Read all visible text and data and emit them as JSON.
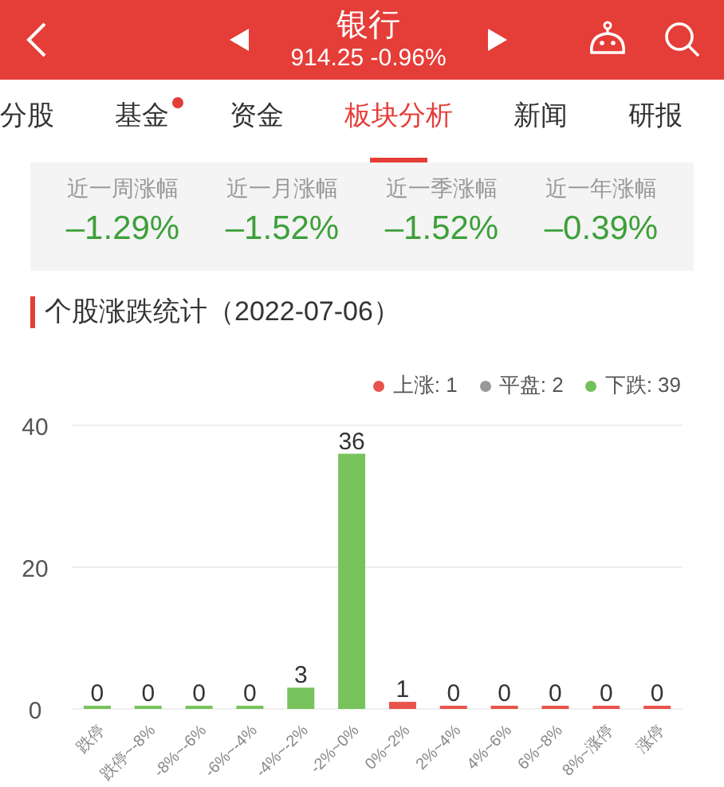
{
  "header": {
    "title": "银行",
    "quote": "914.25 -0.96%"
  },
  "tabs": [
    {
      "label": "分股",
      "selected": false,
      "dot": false
    },
    {
      "label": "基金",
      "selected": false,
      "dot": true
    },
    {
      "label": "资金",
      "selected": false,
      "dot": false
    },
    {
      "label": "板块分析",
      "selected": true,
      "dot": false
    },
    {
      "label": "新闻",
      "selected": false,
      "dot": false
    },
    {
      "label": "研报",
      "selected": false,
      "dot": false
    }
  ],
  "stats": [
    {
      "label": "近一周涨幅",
      "value": "–1.29%"
    },
    {
      "label": "近一月涨幅",
      "value": "–1.52%"
    },
    {
      "label": "近一季涨幅",
      "value": "–1.52%"
    },
    {
      "label": "近一年涨幅",
      "value": "–0.39%"
    }
  ],
  "section_title": "个股涨跌统计（2022-07-06）",
  "legend": [
    {
      "label": "上涨: 1",
      "color": "#e8534b"
    },
    {
      "label": "平盘: 2",
      "color": "#999999"
    },
    {
      "label": "下跌: 39",
      "color": "#72c05a"
    }
  ],
  "chart_data": {
    "type": "bar",
    "categories": [
      "跌停",
      "跌停~-8%",
      "-8%~-6%",
      "-6%~-4%",
      "-4%~-2%",
      "-2%~0%",
      "0%~2%",
      "2%~4%",
      "4%~6%",
      "6%~8%",
      "8%~涨停",
      "涨停"
    ],
    "series": [
      {
        "color": "#78c35c",
        "values": [
          0,
          0,
          0,
          0,
          3,
          36,
          null,
          null,
          null,
          null,
          null,
          null
        ]
      },
      {
        "color": "#e8534b",
        "values": [
          null,
          null,
          null,
          null,
          null,
          null,
          1,
          0,
          0,
          0,
          0,
          0
        ]
      }
    ],
    "ylim": [
      0,
      40
    ],
    "yticks": [
      0,
      20,
      40
    ],
    "data_labels": true
  }
}
